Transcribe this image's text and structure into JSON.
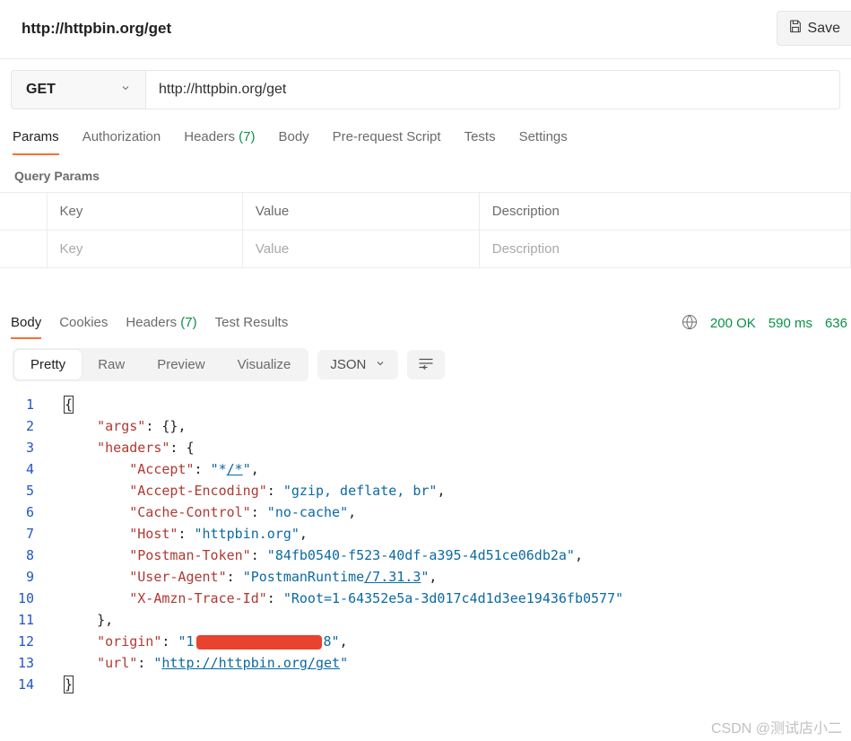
{
  "header": {
    "title": "http://httpbin.org/get",
    "save_label": "Save"
  },
  "request": {
    "method": "GET",
    "url": "http://httpbin.org/get"
  },
  "tabs": {
    "params": "Params",
    "auth": "Authorization",
    "headers": "Headers",
    "headers_count": "(7)",
    "body": "Body",
    "pre": "Pre-request Script",
    "tests": "Tests",
    "settings": "Settings"
  },
  "query_section": {
    "title": "Query Params",
    "cols": {
      "key": "Key",
      "value": "Value",
      "desc": "Description"
    },
    "placeholders": {
      "key": "Key",
      "value": "Value",
      "desc": "Description"
    }
  },
  "response": {
    "tabs": {
      "body": "Body",
      "cookies": "Cookies",
      "headers": "Headers",
      "headers_count": "(7)",
      "tests": "Test Results"
    },
    "status_code": "200 OK",
    "time": "590 ms",
    "size": "636"
  },
  "view": {
    "pretty": "Pretty",
    "raw": "Raw",
    "preview": "Preview",
    "visualize": "Visualize",
    "format": "JSON"
  },
  "body_json": {
    "args": {},
    "headers": {
      "Accept": "*/*",
      "Accept-Encoding": "gzip, deflate, br",
      "Cache-Control": "no-cache",
      "Host": "httpbin.org",
      "Postman-Token": "84fb0540-f523-40df-a395-4d51ce06db2a",
      "User-Agent": "PostmanRuntime/7.31.3",
      "X-Amzn-Trace-Id": "Root=1-64352e5a-3d017c4d1d3ee19436fb0577"
    },
    "origin": "[redacted IP]",
    "url": "http://httpbin.org/get"
  },
  "watermark": "CSDN @测试店小二"
}
